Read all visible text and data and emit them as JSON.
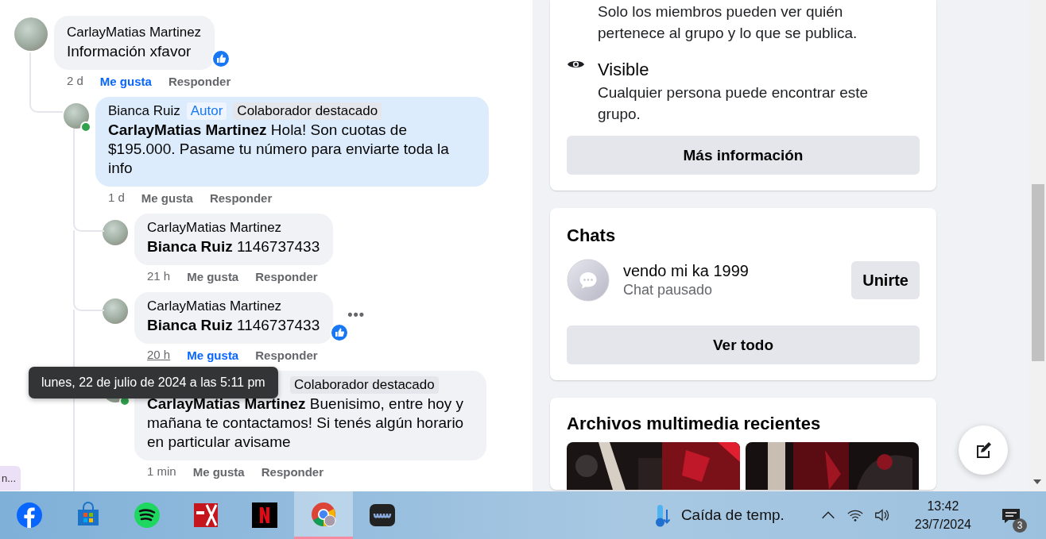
{
  "comments": [
    {
      "author": "CarlayMatias Martinez",
      "text": "Información xfavor",
      "time": "2 d",
      "like_label": "Me gusta",
      "reply_label": "Responder",
      "liked": true,
      "reaction": true,
      "children": [
        {
          "author": "Bianca Ruiz",
          "badges": [
            {
              "text": "Autor",
              "kind": "author"
            },
            {
              "text": "Colaborador destacado",
              "kind": "top"
            }
          ],
          "online": true,
          "highlighted": true,
          "text": "**CarlayMatias Martinez** Hola! Son cuotas de $195.000. Pasame tu número para enviarte toda la info",
          "time": "1 d",
          "like_label": "Me gusta",
          "reply_label": "Responder",
          "liked": false,
          "children": [
            {
              "author": "CarlayMatias Martinez",
              "text": "**Bianca Ruiz** 1146737433",
              "time": "21 h",
              "like_label": "Me gusta",
              "reply_label": "Responder",
              "liked": false
            },
            {
              "author": "CarlayMatias Martinez",
              "text": "**Bianca Ruiz** 1146737433",
              "time": "20 h",
              "time_hovered": true,
              "like_label": "Me gusta",
              "reply_label": "Responder",
              "liked": true,
              "reaction": true,
              "more": "•••"
            },
            {
              "badges": [
                {
                  "text": "Colaborador destacado",
                  "kind": "top"
                }
              ],
              "online": true,
              "text": "**CarlayMatias Martinez** Buenisimo, entre hoy y mañana te contactamos! Si tenés algún horario en particular avisame",
              "time": "1 min",
              "like_label": "Me gusta",
              "reply_label": "Responder",
              "liked": false
            }
          ]
        }
      ]
    }
  ],
  "tooltip": {
    "text": "lunes, 22 de julio de 2024 a las 5:11 pm"
  },
  "side_tab": {
    "text": "n..."
  },
  "about_card": {
    "items": [
      {
        "kind": "private",
        "text": "Solo los miembros pueden ver quién pertenece al grupo y lo que se publica."
      },
      {
        "kind": "visible",
        "title": "Visible",
        "text": "Cualquier persona puede encontrar este grupo."
      }
    ],
    "button": "Más información"
  },
  "chats_card": {
    "title": "Chats",
    "chats": [
      {
        "name": "vendo mi ka 1999",
        "status": "Chat pausado",
        "button": "Unirte"
      }
    ],
    "button": "Ver todo"
  },
  "media_card": {
    "title": "Archivos multimedia recientes"
  },
  "taskbar": {
    "apps": [
      {
        "kind": "facebook",
        "active": false
      },
      {
        "kind": "store",
        "active": false
      },
      {
        "kind": "spotify",
        "active": false
      },
      {
        "kind": "pdf",
        "active": false
      },
      {
        "kind": "netflix",
        "active": false
      },
      {
        "kind": "chrome",
        "active": true
      },
      {
        "kind": "meter",
        "active": false
      }
    ],
    "weather": "Caída de temp.",
    "time": "13:42",
    "date": "23/7/2024",
    "notifications": "3"
  }
}
